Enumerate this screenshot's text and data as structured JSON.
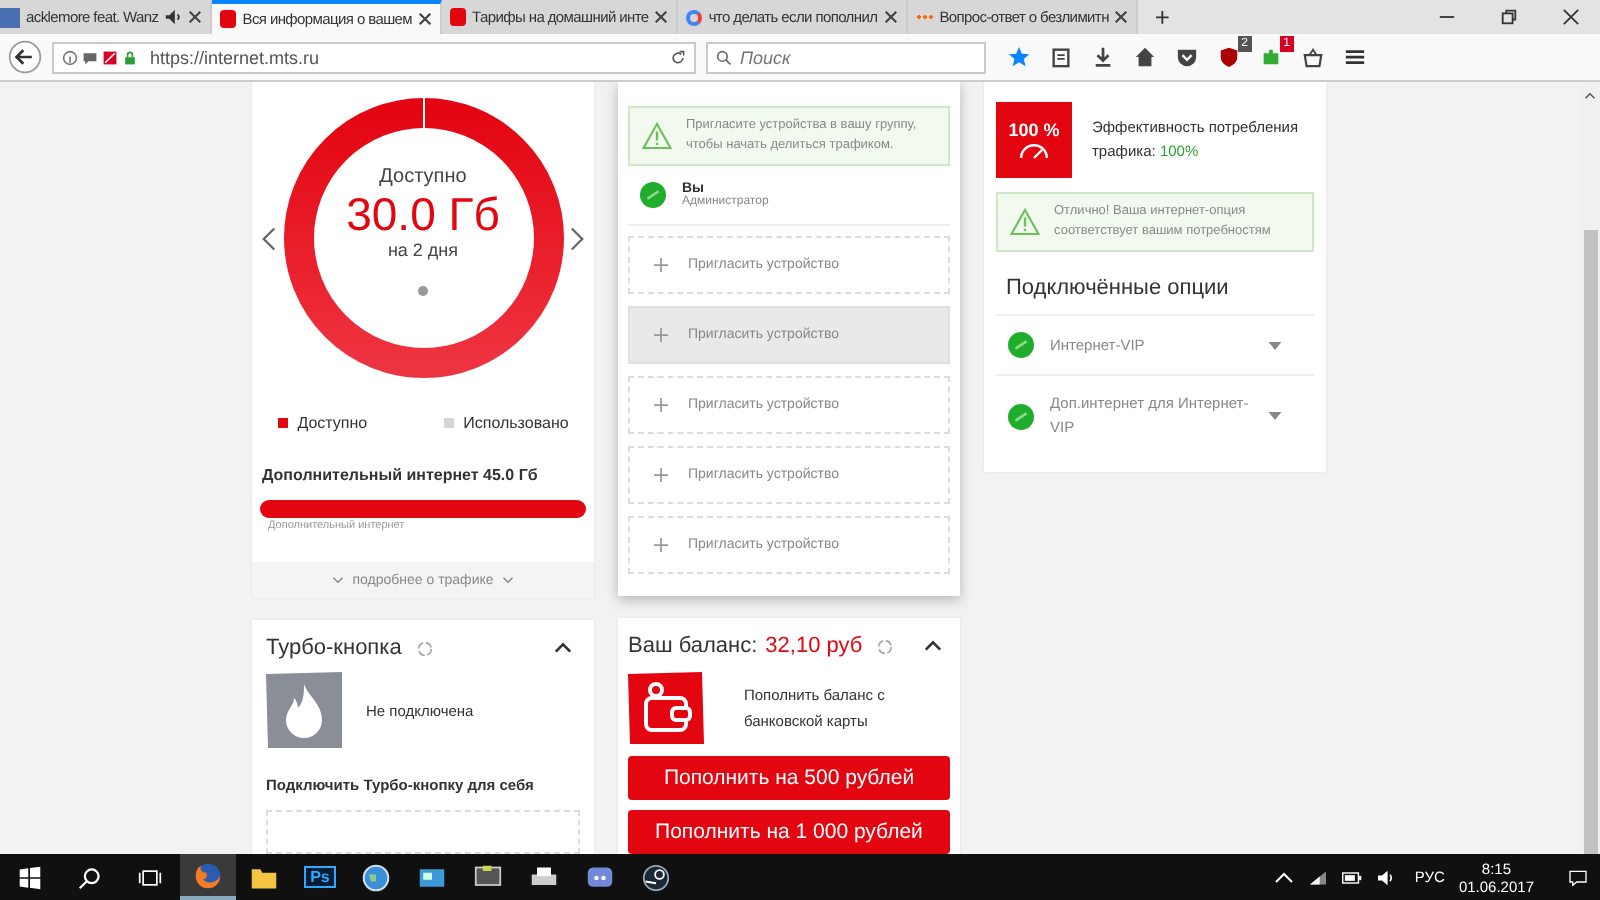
{
  "browser": {
    "tabs": [
      {
        "title": "acklemore feat. Wanz",
        "selected": false,
        "kind": "audio"
      },
      {
        "title": "Вся информация о вашем",
        "selected": true,
        "kind": "mts"
      },
      {
        "title": "Тарифы на домашний инте",
        "selected": false,
        "kind": "mts"
      },
      {
        "title": "что делать если пополнил",
        "selected": false,
        "kind": "google"
      },
      {
        "title": "Вопрос-ответ о безлимитн",
        "selected": false,
        "kind": "dots"
      }
    ],
    "new_tab": "+",
    "url": "https://internet.mts.ru",
    "search_placeholder": "Поиск",
    "badges": [
      "2",
      "1"
    ]
  },
  "traffic": {
    "available_label": "Доступно",
    "amount": "30.0 Гб",
    "period": "на 2 дня",
    "legend": [
      {
        "label": "Доступно",
        "color": "#e30611"
      },
      {
        "label": "Использовано",
        "color": "#d6d6d6"
      }
    ],
    "extra_title": "Дополнительный интернет 45.0 Гб",
    "extra_bar": {
      "level": 1
    },
    "extra_label": "Дополнительный интернет",
    "more_link": "подробнее о трафике"
  },
  "group": {
    "notice": "Пригласите устройства в вашу группу, чтобы начать делиться трафиком.",
    "member_name": "Вы",
    "member_role": "Администратор",
    "invites": [
      {
        "label": "Пригласить устройство",
        "highlighted": false
      },
      {
        "label": "Пригласить устройство",
        "highlighted": true
      },
      {
        "label": "Пригласить устройство",
        "highlighted": false
      },
      {
        "label": "Пригласить устройство",
        "highlighted": false
      },
      {
        "label": "Пригласить устройство",
        "highlighted": false
      }
    ]
  },
  "efficiency": {
    "badge": "100 %",
    "text": "Эффективность потребления трафика:",
    "value": "100%",
    "notice": "Отлично! Ваша интернет-опция соответствует вашим потребностям",
    "options_title": "Подключённые опции",
    "options": [
      {
        "name": "Интернет-VIP"
      },
      {
        "name": "Доп.интернет для Интернет-VIP"
      }
    ]
  },
  "turbo": {
    "title": "Турбо-кнопка",
    "status": "Не подключена",
    "connect_title": "Подключить Турбо-кнопку для себя"
  },
  "balance": {
    "label": "Ваш баланс:",
    "amount": "32,10 руб",
    "topup_text": "Пополнить баланс с банковской карты",
    "buttons": [
      "Пополнить на 500 рублей",
      "Пополнить на 1 000 рублей"
    ]
  },
  "taskbar": {
    "pinned": [
      {
        "kind": "browser",
        "active": true
      },
      {
        "kind": "folder",
        "active": false
      },
      {
        "kind": "ps",
        "label": "Ps",
        "active": false
      },
      {
        "kind": "globe",
        "active": false
      },
      {
        "kind": "window",
        "active": false
      },
      {
        "kind": "game",
        "active": false
      },
      {
        "kind": "printer",
        "active": false
      },
      {
        "kind": "chat",
        "active": false
      },
      {
        "kind": "steam",
        "active": false
      }
    ],
    "lang": "РУС",
    "time": "8:15",
    "date": "01.06.2017"
  }
}
